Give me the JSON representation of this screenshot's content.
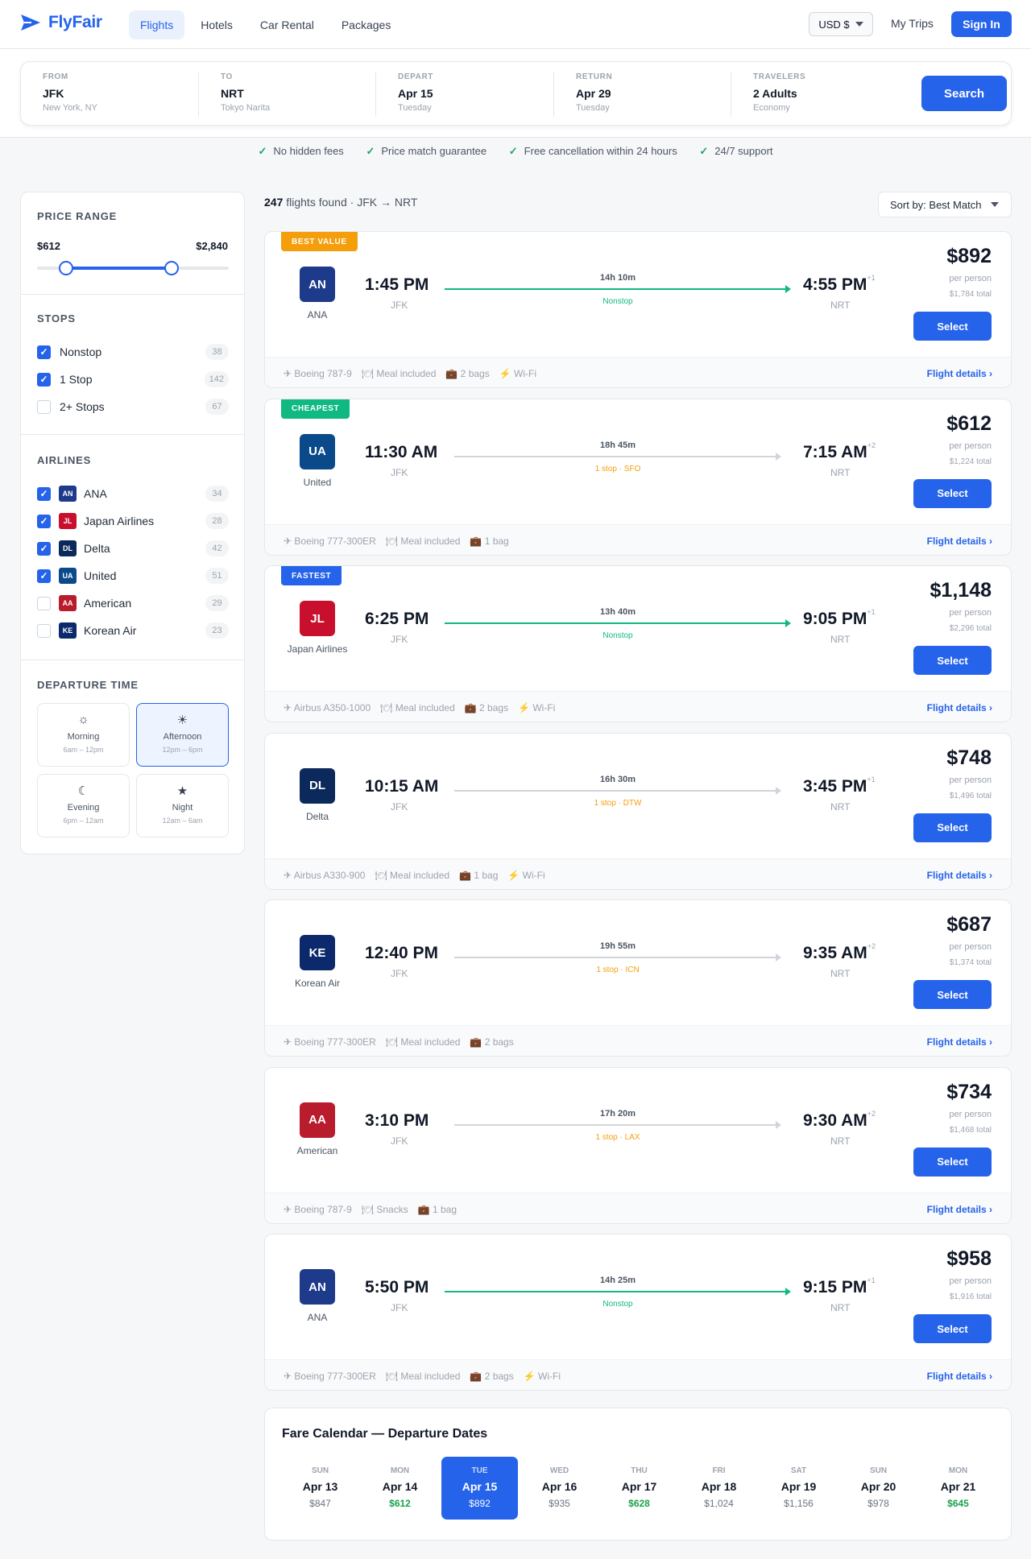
{
  "app": {
    "name": "FlyFair"
  },
  "nav": [
    {
      "label": "Flights",
      "active": true
    },
    {
      "label": "Hotels",
      "active": false
    },
    {
      "label": "Car Rental",
      "active": false
    },
    {
      "label": "Packages",
      "active": false
    }
  ],
  "header": {
    "currency": "USD $",
    "my_trips": "My Trips",
    "sign_in": "Sign In"
  },
  "search": {
    "fields": [
      {
        "label": "FROM",
        "value": "JFK",
        "sub": "New York, NY"
      },
      {
        "label": "TO",
        "value": "NRT",
        "sub": "Tokyo Narita"
      },
      {
        "label": "DEPART",
        "value": "Apr 15",
        "sub": "Tuesday"
      },
      {
        "label": "RETURN",
        "value": "Apr 29",
        "sub": "Tuesday"
      },
      {
        "label": "TRAVELERS",
        "value": "2 Adults",
        "sub": "Economy"
      }
    ],
    "button": "Search"
  },
  "features": [
    "No hidden fees",
    "Price match guarantee",
    "Free cancellation within 24 hours",
    "24/7 support"
  ],
  "filters": {
    "price": {
      "title": "PRICE RANGE",
      "min_label": "$612",
      "max_label": "$2,840",
      "low_fraction": 0.15,
      "high_fraction": 0.7
    },
    "stops": {
      "title": "STOPS",
      "items": [
        {
          "label": "Nonstop",
          "count": "38",
          "checked": true
        },
        {
          "label": "1 Stop",
          "count": "142",
          "checked": true
        },
        {
          "label": "2+ Stops",
          "count": "67",
          "checked": false
        }
      ]
    },
    "airlines": {
      "title": "AIRLINES",
      "items": [
        {
          "code": "AN",
          "label": "ANA",
          "count": "34",
          "checked": true,
          "color": "#1e3a8a"
        },
        {
          "code": "JL",
          "label": "Japan Airlines",
          "count": "28",
          "checked": true,
          "color": "#c8102e"
        },
        {
          "code": "DL",
          "label": "Delta",
          "count": "42",
          "checked": true,
          "color": "#0b2a5b"
        },
        {
          "code": "UA",
          "label": "United",
          "count": "51",
          "checked": true,
          "color": "#0a4a8a"
        },
        {
          "code": "AA",
          "label": "American",
          "count": "29",
          "checked": false,
          "color": "#b91c2c"
        },
        {
          "code": "KE",
          "label": "Korean Air",
          "count": "23",
          "checked": false,
          "color": "#0c2a6b"
        }
      ]
    },
    "departure": {
      "title": "DEPARTURE TIME",
      "slots": [
        {
          "icon": "☼",
          "label": "Morning",
          "range": "6am – 12pm",
          "selected": false
        },
        {
          "icon": "☀",
          "label": "Afternoon",
          "range": "12pm – 6pm",
          "selected": true
        },
        {
          "icon": "☾",
          "label": "Evening",
          "range": "6pm – 12am",
          "selected": false
        },
        {
          "icon": "★",
          "label": "Night",
          "range": "12am – 6am",
          "selected": false
        }
      ]
    }
  },
  "results": {
    "count": "247",
    "suffix": "flights found · JFK → NRT",
    "sort": "Sort by: Best Match"
  },
  "flights": [
    {
      "tag": "BEST VALUE",
      "tag_color": "#f59e0b",
      "code": "AN",
      "airline": "ANA",
      "color": "#1e3a8a",
      "dep": "1:45 PM",
      "dep_code": "JFK",
      "arr": "4:55 PM",
      "plus": "+1",
      "arr_code": "NRT",
      "duration": "14h 10m",
      "stops": "Nonstop",
      "nonstop": true,
      "price": "$892",
      "per": "per person",
      "total": "$1,784 total",
      "select": "Select",
      "amenities": [
        "✈ Boeing 787-9",
        "🍽 Meal included",
        "💼 2 bags",
        "⚡ Wi-Fi"
      ],
      "details": "Flight details ›"
    },
    {
      "tag": "CHEAPEST",
      "tag_color": "#10b981",
      "code": "UA",
      "airline": "United",
      "color": "#0a4a8a",
      "dep": "11:30 AM",
      "dep_code": "JFK",
      "arr": "7:15 AM",
      "plus": "+2",
      "arr_code": "NRT",
      "duration": "18h 45m",
      "stops": "1 stop · SFO",
      "nonstop": false,
      "price": "$612",
      "per": "per person",
      "total": "$1,224 total",
      "select": "Select",
      "amenities": [
        "✈ Boeing 777-300ER",
        "🍽 Meal included",
        "💼 1 bag"
      ],
      "details": "Flight details ›"
    },
    {
      "tag": "FASTEST",
      "tag_color": "#2563eb",
      "code": "JL",
      "airline": "Japan Airlines",
      "color": "#c8102e",
      "dep": "6:25 PM",
      "dep_code": "JFK",
      "arr": "9:05 PM",
      "plus": "+1",
      "arr_code": "NRT",
      "duration": "13h 40m",
      "stops": "Nonstop",
      "nonstop": true,
      "price": "$1,148",
      "per": "per person",
      "total": "$2,296 total",
      "select": "Select",
      "amenities": [
        "✈ Airbus A350-1000",
        "🍽 Meal included",
        "💼 2 bags",
        "⚡ Wi-Fi"
      ],
      "details": "Flight details ›"
    },
    {
      "tag": "",
      "tag_color": "",
      "code": "DL",
      "airline": "Delta",
      "color": "#0b2a5b",
      "dep": "10:15 AM",
      "dep_code": "JFK",
      "arr": "3:45 PM",
      "plus": "+1",
      "arr_code": "NRT",
      "duration": "16h 30m",
      "stops": "1 stop · DTW",
      "nonstop": false,
      "price": "$748",
      "per": "per person",
      "total": "$1,496 total",
      "select": "Select",
      "amenities": [
        "✈ Airbus A330-900",
        "🍽 Meal included",
        "💼 1 bag",
        "⚡ Wi-Fi"
      ],
      "details": "Flight details ›"
    },
    {
      "tag": "",
      "tag_color": "",
      "code": "KE",
      "airline": "Korean Air",
      "color": "#0c2a6b",
      "dep": "12:40 PM",
      "dep_code": "JFK",
      "arr": "9:35 AM",
      "plus": "+2",
      "arr_code": "NRT",
      "duration": "19h 55m",
      "stops": "1 stop · ICN",
      "nonstop": false,
      "price": "$687",
      "per": "per person",
      "total": "$1,374 total",
      "select": "Select",
      "amenities": [
        "✈ Boeing 777-300ER",
        "🍽 Meal included",
        "💼 2 bags"
      ],
      "details": "Flight details ›"
    },
    {
      "tag": "",
      "tag_color": "",
      "code": "AA",
      "airline": "American",
      "color": "#b91c2c",
      "dep": "3:10 PM",
      "dep_code": "JFK",
      "arr": "9:30 AM",
      "plus": "+2",
      "arr_code": "NRT",
      "duration": "17h 20m",
      "stops": "1 stop · LAX",
      "nonstop": false,
      "price": "$734",
      "per": "per person",
      "total": "$1,468 total",
      "select": "Select",
      "amenities": [
        "✈ Boeing 787-9",
        "🍽 Snacks",
        "💼 1 bag"
      ],
      "details": "Flight details ›"
    },
    {
      "tag": "",
      "tag_color": "",
      "code": "AN",
      "airline": "ANA",
      "color": "#1e3a8a",
      "dep": "5:50 PM",
      "dep_code": "JFK",
      "arr": "9:15 PM",
      "plus": "+1",
      "arr_code": "NRT",
      "duration": "14h 25m",
      "stops": "Nonstop",
      "nonstop": true,
      "price": "$958",
      "per": "per person",
      "total": "$1,916 total",
      "select": "Select",
      "amenities": [
        "✈ Boeing 777-300ER",
        "🍽 Meal included",
        "💼 2 bags",
        "⚡ Wi-Fi"
      ],
      "details": "Flight details ›"
    }
  ],
  "calendar": {
    "title": "Fare Calendar — Departure Dates",
    "days": [
      {
        "dow": "SUN",
        "date": "Apr 13",
        "price": "$847",
        "low": false,
        "selected": false
      },
      {
        "dow": "MON",
        "date": "Apr 14",
        "price": "$612",
        "low": true,
        "selected": false
      },
      {
        "dow": "TUE",
        "date": "Apr 15",
        "price": "$892",
        "low": false,
        "selected": true
      },
      {
        "dow": "WED",
        "date": "Apr 16",
        "price": "$935",
        "low": false,
        "selected": false
      },
      {
        "dow": "THU",
        "date": "Apr 17",
        "price": "$628",
        "low": true,
        "selected": false
      },
      {
        "dow": "FRI",
        "date": "Apr 18",
        "price": "$1,024",
        "low": false,
        "selected": false
      },
      {
        "dow": "SAT",
        "date": "Apr 19",
        "price": "$1,156",
        "low": false,
        "selected": false
      },
      {
        "dow": "SUN",
        "date": "Apr 20",
        "price": "$978",
        "low": false,
        "selected": false
      },
      {
        "dow": "MON",
        "date": "Apr 21",
        "price": "$645",
        "low": true,
        "selected": false
      }
    ]
  },
  "colors": {
    "accent": "#2563eb",
    "nonstop": "#10b981",
    "stop": "#f59e0b"
  }
}
